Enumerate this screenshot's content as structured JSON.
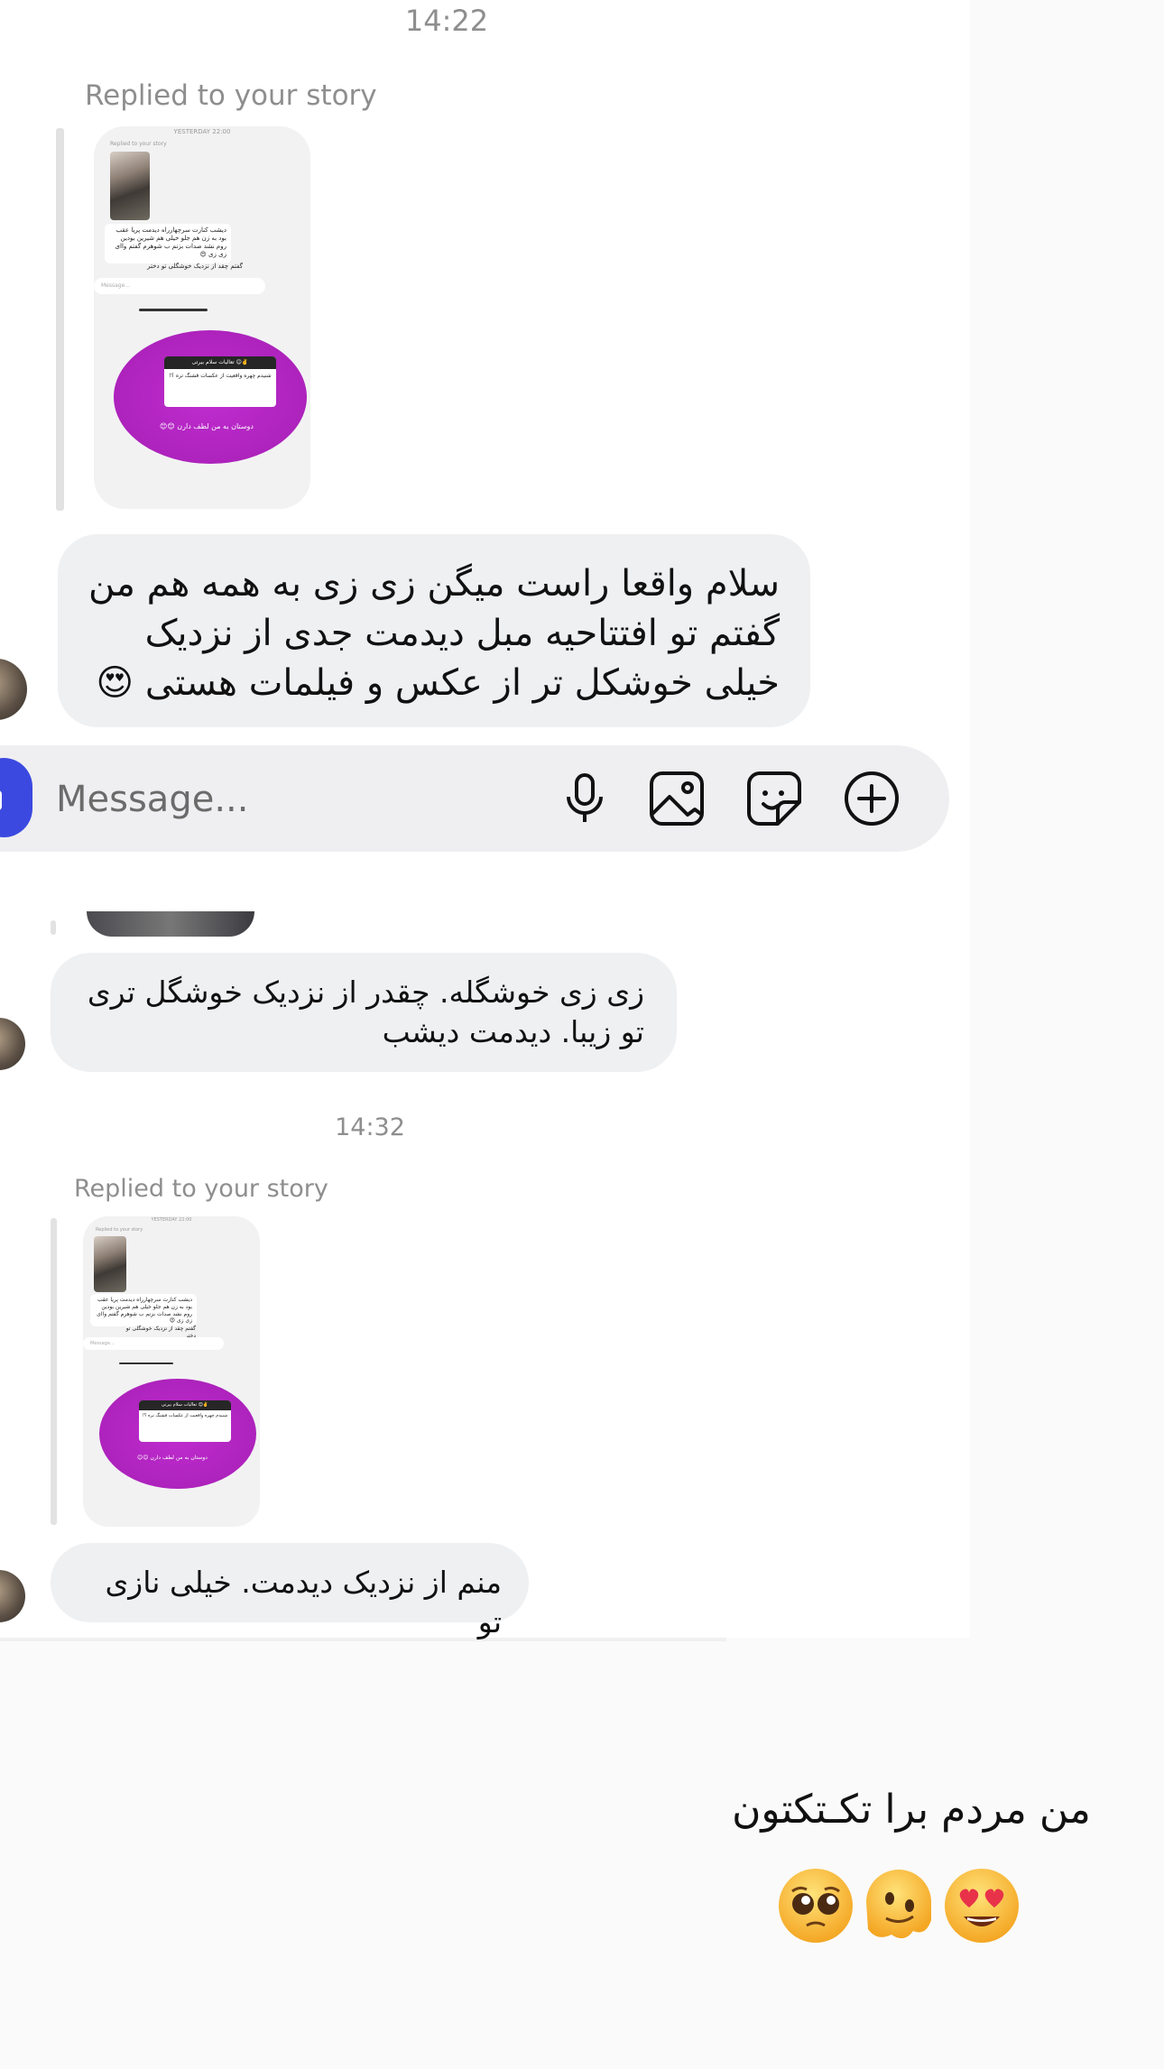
{
  "thread": {
    "time1": "14:22",
    "replied1": "Replied to your story",
    "message1": "سلام واقعا راست میگن زی زی به همه هم من گفتم تو افتتاحیه مبل دیدمت جدی از نزدیک خیلی خوشکل تر از عکس و فیلمات هستی 😍",
    "message2": "زی زی خوشگله. چقدر از نزدیک خوشگل تری تو زیبا. دیدمت دیشب",
    "time2": "14:32",
    "replied2": "Replied to your story",
    "message3": "منم از نزدیک دیدمت. خیلی نازی تو"
  },
  "story_preview": {
    "time": "YESTERDAY 22:00",
    "reply_label": "Replied to your story",
    "reply_text": "دیشب کنارت سرچهارراه دیدمت پریا عقب بود به زن هم جلو خیلی هم شیرین بودین  روم نشد صدات بزنم ب شوهرم گفتم واای زی زی 😍",
    "reply_text_2": "گفتم چقد از نزدیک خوشگلی تو دختر",
    "input_placeholder": "Message...",
    "card_header": "تعالیات سلام بیرتی 😊✌️",
    "card_body": "شنیدم چهره واقعیت از عکسات قشنگ تره ؟!",
    "card_caption": "دوستان به من لطف دارن 😊😊"
  },
  "composer": {
    "placeholder": "Message...",
    "icons": [
      "microphone-icon",
      "image-icon",
      "sticker-icon",
      "add-icon"
    ]
  },
  "caption": {
    "text": "من مردم برا تکـتکتون",
    "emojis": [
      "pleading-face",
      "melting-face",
      "heart-eyes-face"
    ]
  },
  "colors": {
    "bubble": "#eff0f2",
    "accent_blue": "#3b49e0",
    "story_purple": "#b325c2",
    "muted_text": "#8e8e8e"
  }
}
